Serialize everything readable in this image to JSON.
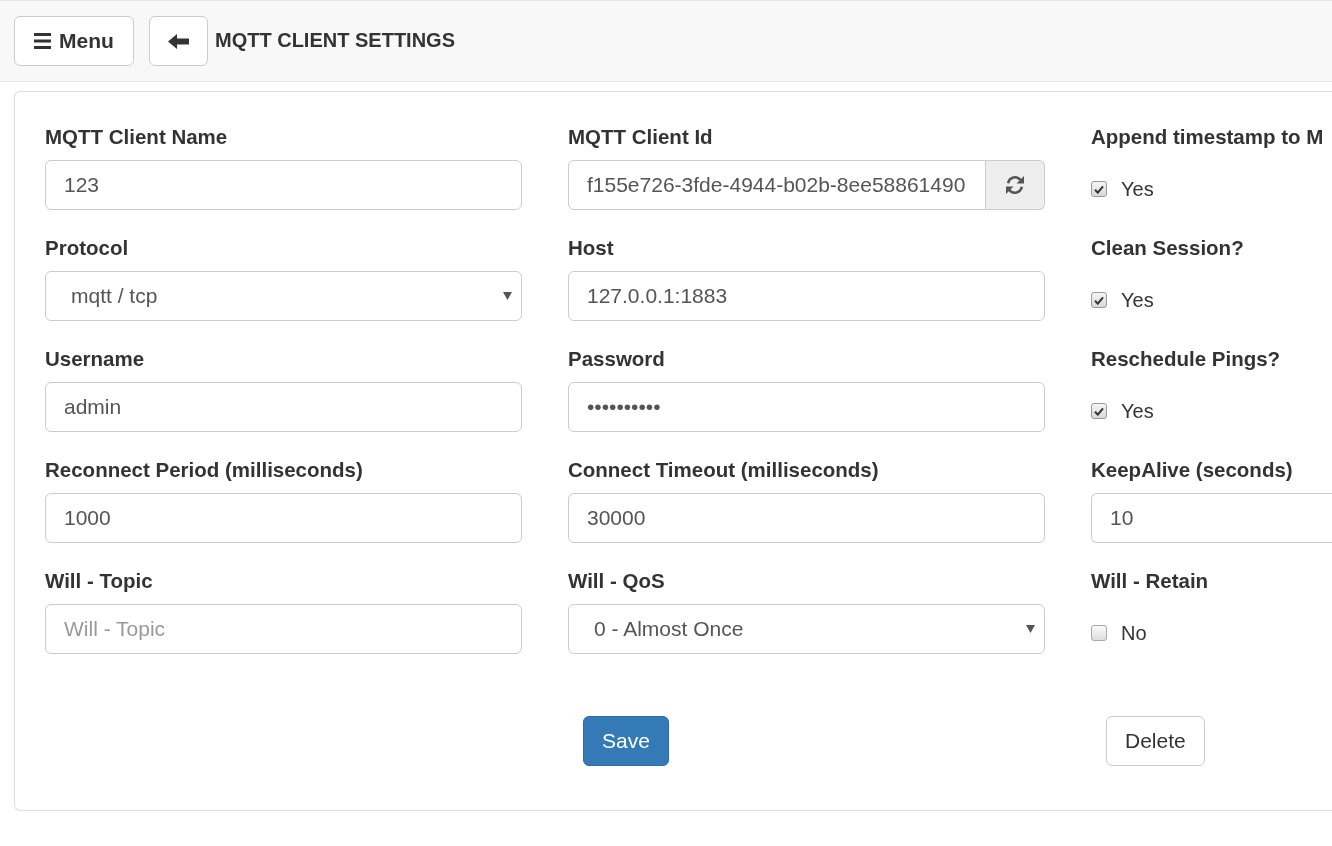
{
  "header": {
    "menu_label": "Menu",
    "title": "MQTT CLIENT SETTINGS"
  },
  "fields": [
    {
      "label": "MQTT Client Name",
      "kind": "text",
      "value": "123"
    },
    {
      "label": "MQTT Client Id",
      "kind": "text_with_button",
      "value": "f155e726-3fde-4944-b02b-8ee58861490"
    },
    {
      "label": "Append timestamp to M",
      "kind": "checkbox",
      "checked": true,
      "option": "Yes"
    },
    {
      "label": "Protocol",
      "kind": "select",
      "value": "mqtt / tcp"
    },
    {
      "label": "Host",
      "kind": "text",
      "value": "127.0.0.1:1883"
    },
    {
      "label": "Clean Session?",
      "kind": "checkbox",
      "checked": true,
      "option": "Yes"
    },
    {
      "label": "Username",
      "kind": "text",
      "value": "admin"
    },
    {
      "label": "Password",
      "kind": "text",
      "value": "••••••••••"
    },
    {
      "label": "Reschedule Pings?",
      "kind": "checkbox",
      "checked": true,
      "option": "Yes"
    },
    {
      "label": "Reconnect Period (milliseconds)",
      "kind": "text",
      "value": "1000"
    },
    {
      "label": "Connect Timeout (milliseconds)",
      "kind": "text",
      "value": "30000"
    },
    {
      "label": "KeepAlive (seconds)",
      "kind": "text",
      "value": "10"
    },
    {
      "label": "Will - Topic",
      "kind": "text",
      "placeholder": "Will - Topic"
    },
    {
      "label": "Will - QoS",
      "kind": "select",
      "value": "0 - Almost Once"
    },
    {
      "label": "Will - Retain",
      "kind": "checkbox",
      "checked": false,
      "option": "No"
    }
  ],
  "buttons": [
    {
      "label": "Save",
      "kind": "primary"
    },
    {
      "label": "Delete",
      "kind": "default"
    }
  ]
}
